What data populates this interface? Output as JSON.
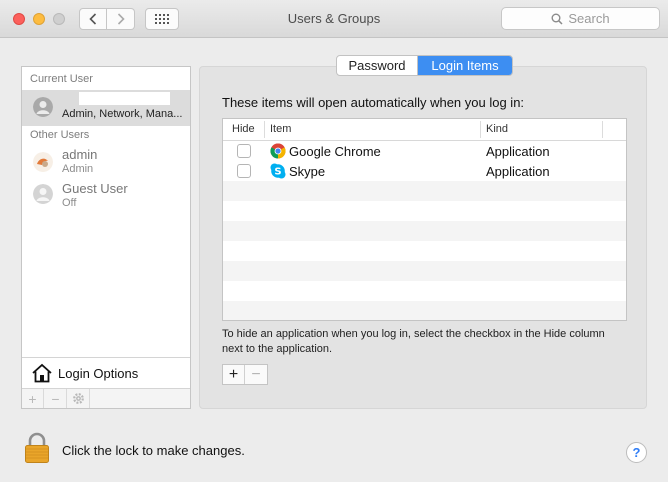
{
  "window": {
    "title": "Users & Groups",
    "search_placeholder": "Search"
  },
  "sidebar": {
    "current_user_heading": "Current User",
    "current_user": {
      "name": "",
      "role": "Admin, Network, Mana..."
    },
    "other_users_heading": "Other Users",
    "other_users": [
      {
        "name": "admin",
        "role": "Admin"
      },
      {
        "name": "Guest User",
        "role": "Off"
      }
    ],
    "login_options_label": "Login Options",
    "toolbar": {
      "add": "+",
      "remove": "−"
    }
  },
  "tabs": [
    {
      "label": "Password",
      "active": false
    },
    {
      "label": "Login Items",
      "active": true
    }
  ],
  "login_items": {
    "intro": "These items will open automatically when you log in:",
    "columns": {
      "hide": "Hide",
      "item": "Item",
      "kind": "Kind"
    },
    "rows": [
      {
        "hidden": false,
        "name": "Google Chrome",
        "kind": "Application",
        "icon": "chrome-icon"
      },
      {
        "hidden": false,
        "name": "Skype",
        "kind": "Application",
        "icon": "skype-icon"
      }
    ],
    "hint": "To hide an application when you log in, select the checkbox in the Hide column next to the application.",
    "add_label": "+",
    "remove_label": "−"
  },
  "footer": {
    "lock_text": "Click the lock to make changes.",
    "help_label": "?"
  },
  "colors": {
    "accent": "#3d8ef2",
    "close": "#fc605c",
    "minimize": "#fdbc40",
    "lock_gold": "#e9a52a"
  }
}
